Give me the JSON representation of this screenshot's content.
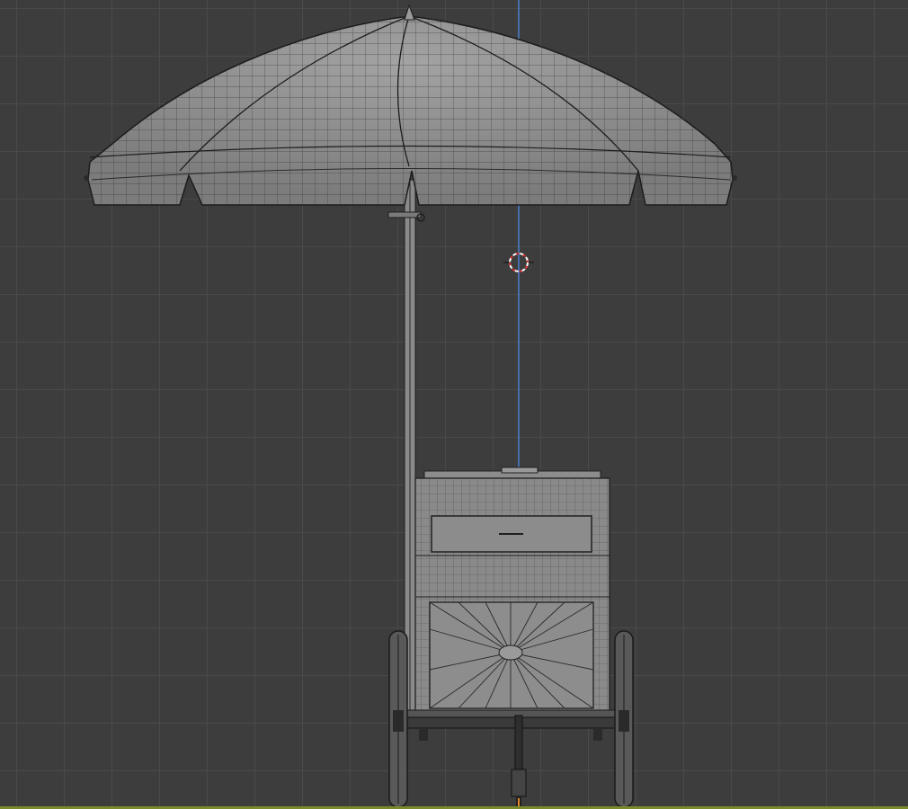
{
  "viewport": {
    "mode": "wireframe-front-orthographic",
    "background_color": "#3d3d3d",
    "grid_color": "#4a4a4a"
  },
  "scene": {
    "object": "vendor-cart-with-umbrella",
    "umbrella": {
      "panels": 12,
      "fill": "#8e8e8e",
      "wire": "#262626"
    },
    "cart": {
      "fill": "#8a8a8a",
      "wire": "#2a2a2a"
    },
    "z_axis_color": "#4d7fcf",
    "x_axis_color": "#9ab12c",
    "cursor_icon": "3d-cursor-icon"
  }
}
